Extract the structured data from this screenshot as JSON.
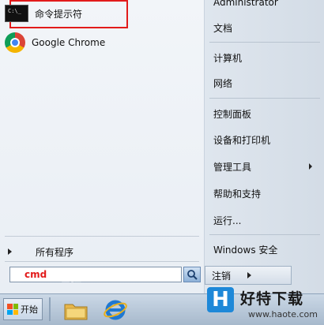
{
  "pinned_programs": [
    {
      "label": "命令提示符",
      "icon": "cmd-icon"
    },
    {
      "label": "Google Chrome",
      "icon": "chrome-icon"
    }
  ],
  "all_programs_label": "所有程序",
  "search": {
    "value": "cmd",
    "button_icon": "search-icon"
  },
  "right_items": [
    {
      "label": "Administrator"
    },
    {
      "label": "文档"
    },
    {
      "label": "计算机"
    },
    {
      "label": "网络"
    },
    {
      "label": "控制面板"
    },
    {
      "label": "设备和打印机"
    },
    {
      "label": "管理工具",
      "has_submenu": true
    },
    {
      "label": "帮助和支持"
    },
    {
      "label": "运行..."
    },
    {
      "label": "Windows 安全"
    }
  ],
  "logoff_label": "注销",
  "taskbar": {
    "start_label": "开始"
  },
  "watermark": {
    "logo": "H",
    "title": "好特下载",
    "url": "www.haote.com",
    "faint_text": "经验"
  },
  "colors": {
    "highlight": "#e21b1b",
    "search_text": "#e21b1b",
    "brand_blue": "#1e88d8"
  }
}
